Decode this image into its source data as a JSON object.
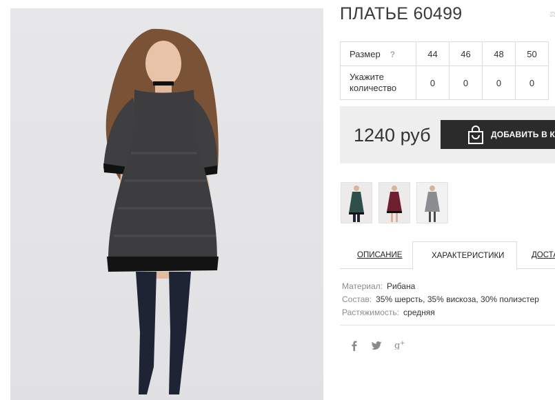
{
  "product": {
    "title": "ПЛАТЬЕ 60499",
    "image_alt": "product-photo",
    "compare_icon": "compare-icon"
  },
  "sizes": {
    "header_label": "Размер",
    "help": "?",
    "quantity_label": "Укажите количество",
    "columns": [
      "44",
      "46",
      "48",
      "50"
    ],
    "quantities": [
      "0",
      "0",
      "0",
      "0"
    ]
  },
  "purchase": {
    "price": "1240 руб",
    "add_to_cart": "ДОБАВИТЬ В КОРЗИНУ",
    "icon": "shopping-bag-icon"
  },
  "thumbnails": [
    {
      "name": "green-dress-thumbnail",
      "color": "#2f4f4a"
    },
    {
      "name": "burgundy-dress-thumbnail",
      "color": "#6e2030"
    },
    {
      "name": "gray-dress-thumbnail",
      "color": "#8b8d90"
    }
  ],
  "tabs": [
    {
      "label": "ОПИСАНИЕ",
      "active": false
    },
    {
      "label": "ХАРАКТЕРИСТИКИ",
      "active": true
    },
    {
      "label": "ДОСТАВКА",
      "active": false
    }
  ],
  "characteristics": [
    {
      "key": "Материал:",
      "value": "Рибана"
    },
    {
      "key": "Состав:",
      "value": "35% шерсть, 35% вискоза, 30% полиэстер"
    },
    {
      "key": "Растяжимость:",
      "value": "средняя"
    }
  ],
  "social": [
    {
      "name": "facebook-icon",
      "glyph": "f"
    },
    {
      "name": "twitter-icon",
      "glyph": "t"
    },
    {
      "name": "google-plus-icon",
      "glyph": "g+"
    }
  ],
  "colors": {
    "button_bg": "#2b2b2b",
    "price_box_bg": "#eeeeee",
    "dress": "#3d3d3f",
    "boots": "#1e2433"
  }
}
